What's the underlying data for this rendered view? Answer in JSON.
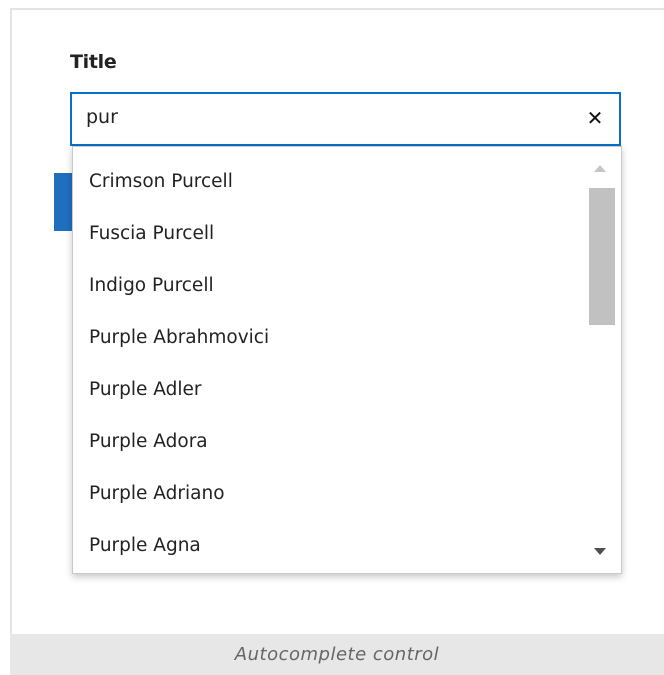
{
  "field": {
    "label": "Title",
    "value": "pur",
    "clear_symbol": "✕"
  },
  "suggestions": [
    "Crimson Purcell",
    "Fuscia Purcell",
    "Indigo Purcell",
    "Purple Abrahmovici",
    "Purple Adler",
    "Purple Adora",
    "Purple Adriano",
    "Purple Agna"
  ],
  "caption": "Autocomplete control",
  "colors": {
    "focus_border": "#0a6fc9",
    "accent": "#1f6fbf",
    "caption_bg": "#e7e7e7"
  }
}
